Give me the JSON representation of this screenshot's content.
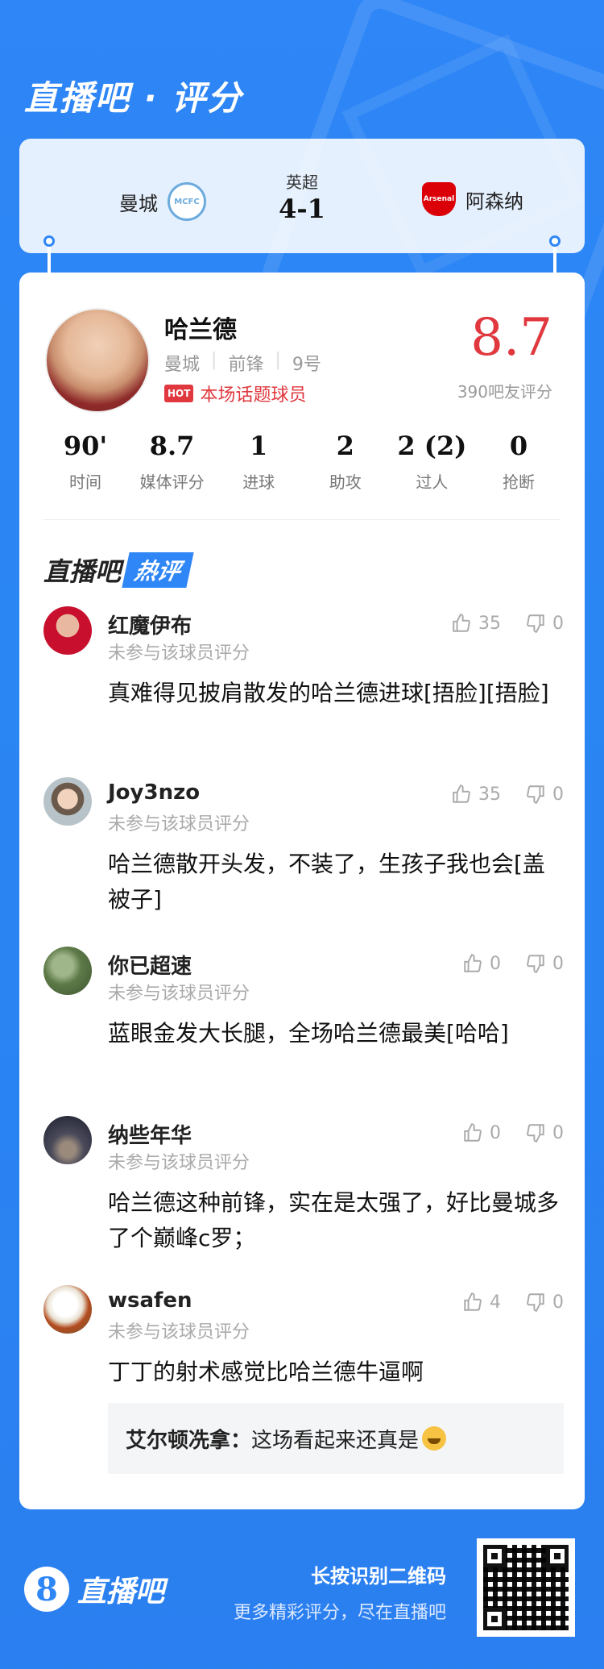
{
  "header": {
    "title": "直播吧 · 评分"
  },
  "match": {
    "league": "英超",
    "score": "4-1",
    "home_team": "曼城",
    "away_team": "阿森纳",
    "home_badge_text": "MCFC",
    "away_badge_text": "Arsenal"
  },
  "player": {
    "name": "哈兰德",
    "club": "曼城",
    "position": "前锋",
    "number": "9号",
    "hot_label": "本场话题球员",
    "hot_icon_text": "HOT",
    "rating": "8.7",
    "rating_count": "390吧友评分"
  },
  "stats": [
    {
      "value": "90'",
      "label": "时间"
    },
    {
      "value": "8.7",
      "label": "媒体评分"
    },
    {
      "value": "1",
      "label": "进球"
    },
    {
      "value": "2",
      "label": "助攻"
    },
    {
      "value": "2 (2)",
      "label": "过人"
    },
    {
      "value": "0",
      "label": "抢断"
    }
  ],
  "hot_section": {
    "title_a": "直播吧",
    "title_b": "热评"
  },
  "comments": [
    {
      "name": "红魔伊布",
      "sub": "未参与该球员评分",
      "text": "真难得见披肩散发的哈兰德进球[捂脸][捂脸]",
      "likes": "35",
      "dislikes": "0"
    },
    {
      "name": "Joy3nzo",
      "sub": "未参与该球员评分",
      "text": "哈兰德散开头发，不装了，生孩子我也会[盖被子]",
      "likes": "35",
      "dislikes": "0"
    },
    {
      "name": "你已超速",
      "sub": "未参与该球员评分",
      "text": "蓝眼金发大长腿，全场哈兰德最美[哈哈]",
      "likes": "0",
      "dislikes": "0"
    },
    {
      "name": "纳些年华",
      "sub": "未参与该球员评分",
      "text": "哈兰德这种前锋，实在是太强了，好比曼城多了个巅峰c罗；",
      "likes": "0",
      "dislikes": "0"
    },
    {
      "name": "wsafen",
      "sub": "未参与该球员评分",
      "text": "丁丁的射术感觉比哈兰德牛逼啊",
      "likes": "4",
      "dislikes": "0"
    }
  ],
  "reply": {
    "name": "艾尔顿冼拿：",
    "text": "这场看起来还真是"
  },
  "footer": {
    "logo_char": "8",
    "logo_text": "直播吧",
    "line1": "长按识别二维码",
    "line2": "更多精彩评分，尽在直播吧"
  }
}
